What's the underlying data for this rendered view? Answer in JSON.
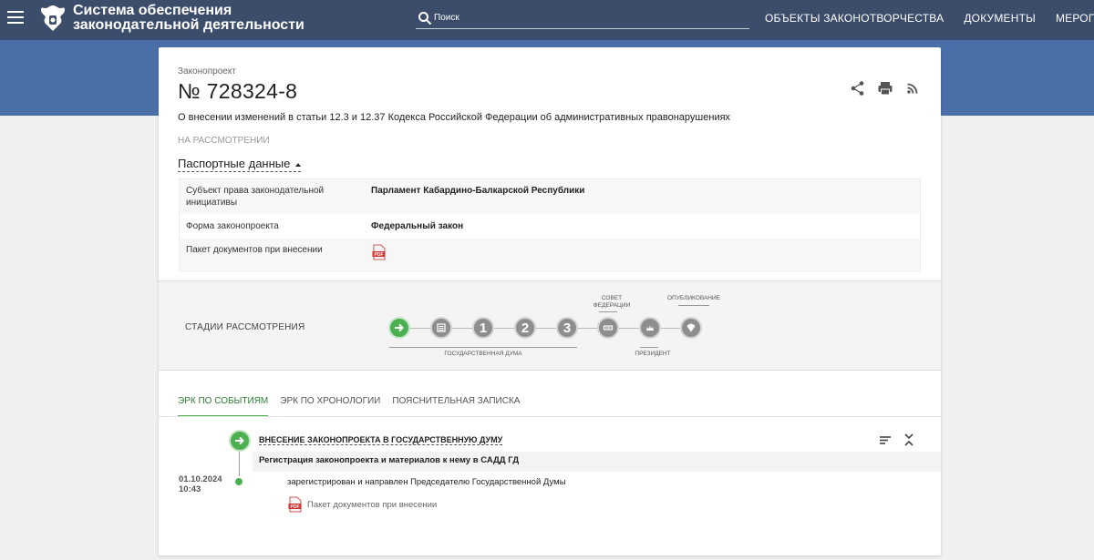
{
  "header": {
    "site_title_line1": "Система обеспечения",
    "site_title_line2": "законодательной деятельности",
    "search_placeholder": "Поиск",
    "nav": [
      "ОБЪЕКТЫ ЗАКОНОТВОРЧЕСТВА",
      "ДОКУМЕНТЫ",
      "МЕРОПРИЯТИЯ"
    ]
  },
  "bill": {
    "label": "Законопроект",
    "number": "№ 728324-8",
    "title": "О внесении изменений в статьи 12.3 и 12.37 Кодекса Российской Федерации об административных правонарушениях",
    "status": "НА РАССМОТРЕНИИ",
    "passport_toggle": "Паспортные данные",
    "passport": [
      {
        "key": "Субъект права законодательной инициативы",
        "value": "Парламент Кабардино-Балкарской Республики"
      },
      {
        "key": "Форма законопроекта",
        "value": "Федеральный закон"
      },
      {
        "key": "Пакет документов при внесении",
        "value": ""
      }
    ]
  },
  "stages": {
    "title": "СТАДИИ РАССМОТРЕНИЯ",
    "numbers": [
      "1",
      "2",
      "3"
    ],
    "labels": {
      "duma": "ГОСУДАРСТВЕННАЯ ДУМА",
      "council": "СОВЕТ ФЕДЕРАЦИИ",
      "president": "ПРЕЗИДЕНТ",
      "publication": "ОПУБЛИКОВАНИЕ"
    }
  },
  "tabs": [
    "ЭРК ПО СОБЫТИЯМ",
    "ЭРК ПО ХРОНОЛОГИИ",
    "ПОЯСНИТЕЛЬНАЯ ЗАПИСКА"
  ],
  "event": {
    "title": "ВНЕСЕНИЕ ЗАКОНОПРОЕКТА В ГОСУДАРСТВЕННУЮ ДУМУ",
    "subtitle": "Регистрация законопроекта и материалов к нему в САДД ГД",
    "date": "01.10.2024",
    "time": "10:43",
    "text": "зарегистрирован и направлен Председателю Государственной Думы",
    "doc": "Пакет документов при внесении"
  },
  "colors": {
    "header": "#3b4d6a",
    "band": "#4a6fa8",
    "accent": "#4caf50"
  }
}
